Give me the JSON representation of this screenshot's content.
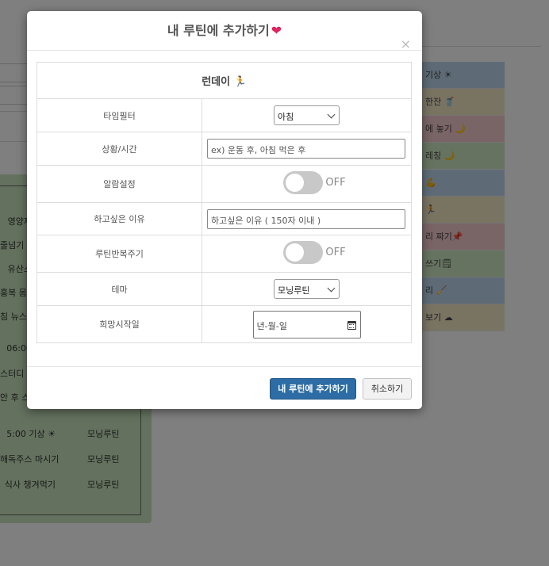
{
  "background": {
    "right_list": [
      "기상 ☀",
      "한잔 🥤",
      "에 놓기 🌙",
      "레칭 🌙",
      "💪",
      "🏃",
      "리 짜기📌",
      "쓰기🗒",
      "리 🧹",
      "보기 ☁"
    ],
    "left_rows": [
      {
        "c1": "영양제",
        "c2": ""
      },
      {
        "c1": "줄넘기 1",
        "c2": ""
      },
      {
        "c1": "유산소",
        "c2": ""
      },
      {
        "c1": "홍복 몸통",
        "c2": ""
      },
      {
        "c1": "침 뉴스 하기",
        "c2": ""
      },
      {
        "c1": "06:00",
        "c2": ""
      },
      {
        "c1": "스터디 3",
        "c2": ""
      },
      {
        "c1": "안 후 스 기",
        "c2": ""
      },
      {
        "c1": "5:00 기상 ☀",
        "c2": "모닝루틴"
      },
      {
        "c1": "해독주스 마시기",
        "c2": "모닝루틴"
      },
      {
        "c1": "식사 챙겨먹기",
        "c2": "모닝루틴"
      }
    ],
    "right_list_colors": [
      "#bcd7ec",
      "#f2e6c5",
      "#f2c8cc",
      "#cde6c0",
      "#bcd7ec",
      "#f2e6c5",
      "#f2c8cc",
      "#cde6c0",
      "#bcd7ec",
      "#f2e6c5"
    ]
  },
  "modal": {
    "title": "내 루틴에 추가하기",
    "title_icon": "heart-icon",
    "close_label": "×",
    "routine_name": "런데이",
    "routine_icon": "🏃",
    "fields": {
      "time_filter": {
        "label": "타임필터",
        "value": "아침"
      },
      "situation": {
        "label": "상황/시간",
        "placeholder": "ex) 운동 후, 아침 먹은 후"
      },
      "alarm": {
        "label": "알람설정",
        "state": "OFF"
      },
      "reason": {
        "label": "하고싶은 이유",
        "placeholder": "하고싶은 이유 ( 150자 이내 )"
      },
      "repeat": {
        "label": "루틴반복주기",
        "state": "OFF"
      },
      "theme": {
        "label": "테마",
        "value": "모닝루틴"
      },
      "start_date": {
        "label": "희망시작일",
        "placeholder": "년-월-일"
      }
    },
    "buttons": {
      "submit": "내 루틴에 추가하기",
      "cancel": "취소하기"
    }
  }
}
